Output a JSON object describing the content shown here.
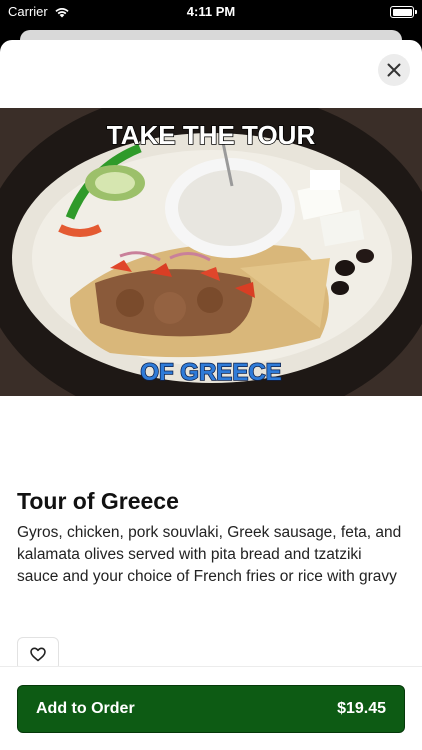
{
  "status_bar": {
    "carrier": "Carrier",
    "time": "4:11 PM",
    "battery_level": 1.0
  },
  "item": {
    "image_caption_top": "TAKE THE TOUR",
    "image_caption_bottom": "OF GREECE",
    "title": "Tour of Greece",
    "description": "Gyros, chicken, pork souvlaki, Greek sausage, feta, and kalamata olives served with pita bread and tzatziki sauce and your choice of French fries or rice with gravy"
  },
  "footer": {
    "add_label": "Add to Order",
    "price": "$19.45"
  },
  "colors": {
    "primary_button": "#0d5b14",
    "sheet_background": "#ffffff"
  },
  "icons": [
    "wifi-icon",
    "battery-icon",
    "close-icon",
    "heart-icon"
  ]
}
